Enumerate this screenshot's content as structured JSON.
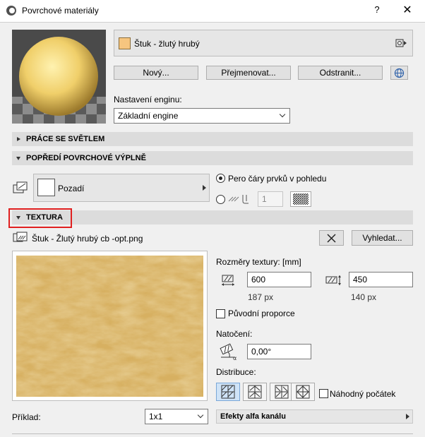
{
  "window": {
    "title": "Povrchové materiály",
    "help": "?",
    "close": "✕"
  },
  "material": {
    "name": "Štuk - žlutý hrubý",
    "swatch_color": "#f6c57f",
    "new_label": "Nový...",
    "rename_label": "Přejmenovat...",
    "delete_label": "Odstranit..."
  },
  "engine": {
    "label": "Nastavení enginu:",
    "value": "Základní engine"
  },
  "sections": {
    "light": "PRÁCE SE SVĚTLEM",
    "foreground": "POPŘEDÍ POVRCHOVÉ VÝPLNĚ",
    "texture": "TEXTURA"
  },
  "foreground": {
    "fill_label": "Pozadí",
    "radio_pen": "Pero čáry prvků v pohledu",
    "pen_value": "1"
  },
  "texture": {
    "file": "Štuk - Žlutý hrubý cb -opt.png",
    "search_label": "Vyhledat...",
    "size_label": "Rozměry textury: [mm]",
    "width": "600",
    "height": "450",
    "width_px": "187 px",
    "height_px": "140 px",
    "proportions_label": "Původní proporce",
    "rotation_label": "Natočení:",
    "rotation_value": "0,00°",
    "distribution_label": "Distribuce:",
    "random_label": "Náhodný počátek"
  },
  "bottom": {
    "example_label": "Příklad:",
    "example_value": "1x1",
    "alpha_label": "Efekty alfa kanálu"
  },
  "colors": {
    "highlight_border": "#e02020",
    "accent": "#2b5fa8"
  }
}
